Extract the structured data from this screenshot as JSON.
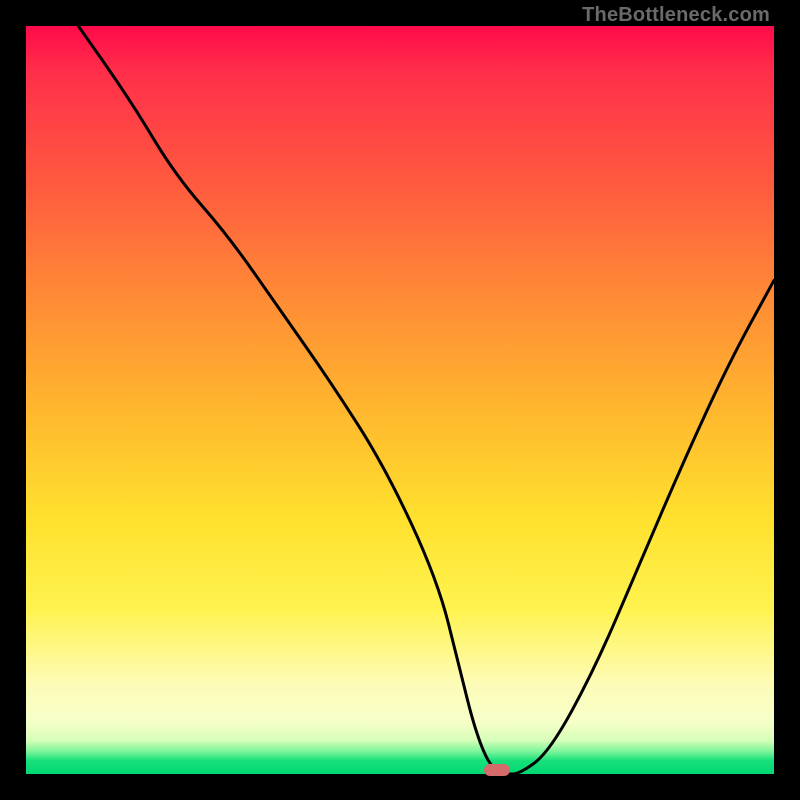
{
  "watermark": {
    "text": "TheBottleneck.com"
  },
  "chart_data": {
    "type": "line",
    "title": "",
    "xlabel": "",
    "ylabel": "",
    "xlim": [
      0,
      100
    ],
    "ylim": [
      0,
      100
    ],
    "grid": false,
    "legend": false,
    "background_gradient": {
      "stops": [
        {
          "pos": 0.0,
          "color": "#ff0a4a"
        },
        {
          "pos": 0.2,
          "color": "#ff5740"
        },
        {
          "pos": 0.5,
          "color": "#ffb92e"
        },
        {
          "pos": 0.78,
          "color": "#fff350"
        },
        {
          "pos": 0.93,
          "color": "#f7ffc9"
        },
        {
          "pos": 0.97,
          "color": "#7cf59a"
        },
        {
          "pos": 1.0,
          "color": "#00d873"
        }
      ]
    },
    "series": [
      {
        "name": "bottleneck-curve",
        "color": "#000000",
        "x": [
          7,
          14,
          20,
          27,
          34,
          41,
          48,
          55,
          58,
          60,
          62,
          64,
          66,
          70,
          76,
          82,
          88,
          94,
          100
        ],
        "values": [
          100,
          90,
          80,
          72,
          62,
          52,
          41,
          26,
          14,
          6,
          1,
          0,
          0,
          3,
          14,
          28,
          42,
          55,
          66
        ]
      }
    ],
    "marker": {
      "x": 63,
      "y": 0,
      "color": "#d46a6a",
      "shape": "pill"
    }
  }
}
